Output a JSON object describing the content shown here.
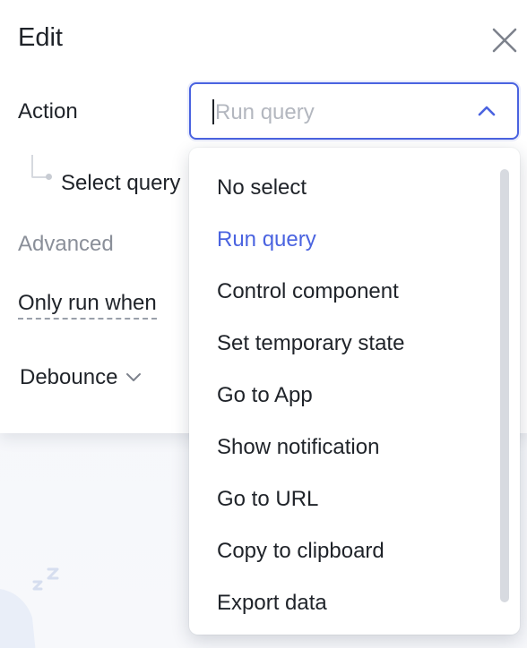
{
  "panel": {
    "title": "Edit",
    "close_icon": "close-icon"
  },
  "form": {
    "action_label": "Action",
    "select_query_label": "Select query",
    "advanced_label": "Advanced",
    "only_run_when_label": "Only run when",
    "debounce_label": "Debounce"
  },
  "action_select": {
    "placeholder": "Run query",
    "open": true,
    "accent_color": "#4a63e0"
  },
  "dropdown": {
    "options": [
      {
        "label": "No select",
        "selected": false
      },
      {
        "label": "Run query",
        "selected": true
      },
      {
        "label": "Control component",
        "selected": false
      },
      {
        "label": "Set temporary state",
        "selected": false
      },
      {
        "label": "Go to App",
        "selected": false
      },
      {
        "label": "Show notification",
        "selected": false
      },
      {
        "label": "Go to URL",
        "selected": false
      },
      {
        "label": "Copy to clipboard",
        "selected": false
      },
      {
        "label": "Export data",
        "selected": false
      }
    ]
  },
  "icons": {
    "close": "close-icon",
    "chevron_up": "chevron-up-icon",
    "chevron_down": "chevron-down-icon",
    "sleep": "sleep-zz-icon"
  }
}
